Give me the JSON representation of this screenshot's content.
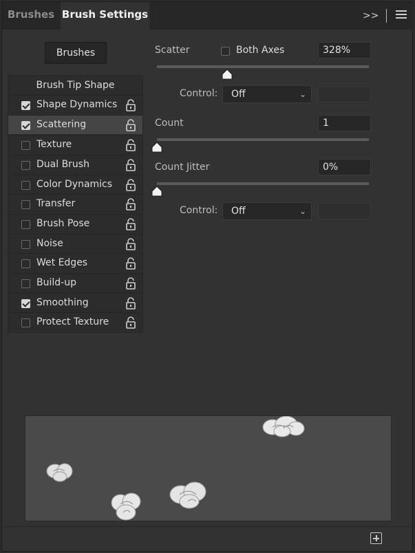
{
  "tabs": [
    {
      "label": "Brushes",
      "active": false
    },
    {
      "label": "Brush Settings",
      "active": true
    }
  ],
  "tab_icons": [
    "expand-panel-icon",
    "panel-menu-icon"
  ],
  "brushes_button": "Brushes",
  "brush_tip_shape": "Brush Tip Shape",
  "options": [
    {
      "label": "Shape Dynamics",
      "checked": true,
      "selected": false
    },
    {
      "label": "Scattering",
      "checked": true,
      "selected": true
    },
    {
      "label": "Texture",
      "checked": false,
      "selected": false
    },
    {
      "label": "Dual Brush",
      "checked": false,
      "selected": false
    },
    {
      "label": "Color Dynamics",
      "checked": false,
      "selected": false
    },
    {
      "label": "Transfer",
      "checked": false,
      "selected": false
    },
    {
      "label": "Brush Pose",
      "checked": false,
      "selected": false
    },
    {
      "label": "Noise",
      "checked": false,
      "selected": false
    },
    {
      "label": "Wet Edges",
      "checked": false,
      "selected": false
    },
    {
      "label": "Build-up",
      "checked": false,
      "selected": false
    },
    {
      "label": "Smoothing",
      "checked": true,
      "selected": false
    },
    {
      "label": "Protect Texture",
      "checked": false,
      "selected": false
    }
  ],
  "scatter": {
    "label": "Scatter",
    "both_axes_label": "Both Axes",
    "both_axes_checked": false,
    "value": "328%",
    "slider_fraction": 0.33,
    "control_label": "Control:",
    "control_value": "Off"
  },
  "count": {
    "label": "Count",
    "value": "1",
    "slider_fraction": 0.0
  },
  "count_jitter": {
    "label": "Count Jitter",
    "value": "0%",
    "slider_fraction": 0.0,
    "control_label": "Control:",
    "control_value": "Off"
  },
  "colors": {
    "panel_bg": "#323232",
    "tab_bar_bg": "#262626",
    "selected_row": "#454545",
    "preview_bg": "#4a4a4a"
  },
  "footer_icon": "new-brush-preset-icon"
}
